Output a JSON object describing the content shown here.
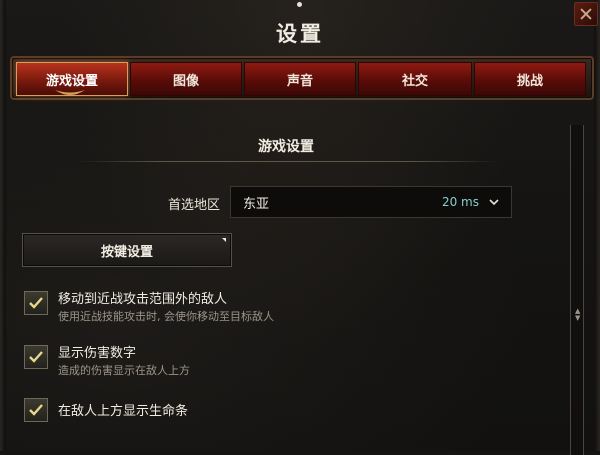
{
  "window": {
    "title": "设置"
  },
  "tabs": [
    {
      "label": "游戏设置",
      "active": true
    },
    {
      "label": "图像",
      "active": false
    },
    {
      "label": "声音",
      "active": false
    },
    {
      "label": "社交",
      "active": false
    },
    {
      "label": "挑战",
      "active": false
    }
  ],
  "section": {
    "title": "游戏设置"
  },
  "region": {
    "label": "首选地区",
    "value": "东亚",
    "ping": "20 ms"
  },
  "keybind": {
    "label": "按键设置"
  },
  "options": [
    {
      "label": "移动到近战攻击范围外的敌人",
      "description": "使用近战技能攻击时, 会使你移动至目标敌人",
      "checked": true
    },
    {
      "label": "显示伤害数字",
      "description": "造成的伤害显示在敌人上方",
      "checked": true
    },
    {
      "label": "在敌人上方显示生命条",
      "description": "",
      "checked": true
    }
  ],
  "colors": {
    "accent_gold": "#d4a05a",
    "tab_red": "#8e1a12",
    "ping_teal": "#86cfcf"
  },
  "icons": {
    "close": "close-icon",
    "dropdown": "chevron-down-icon",
    "check": "check-icon"
  }
}
